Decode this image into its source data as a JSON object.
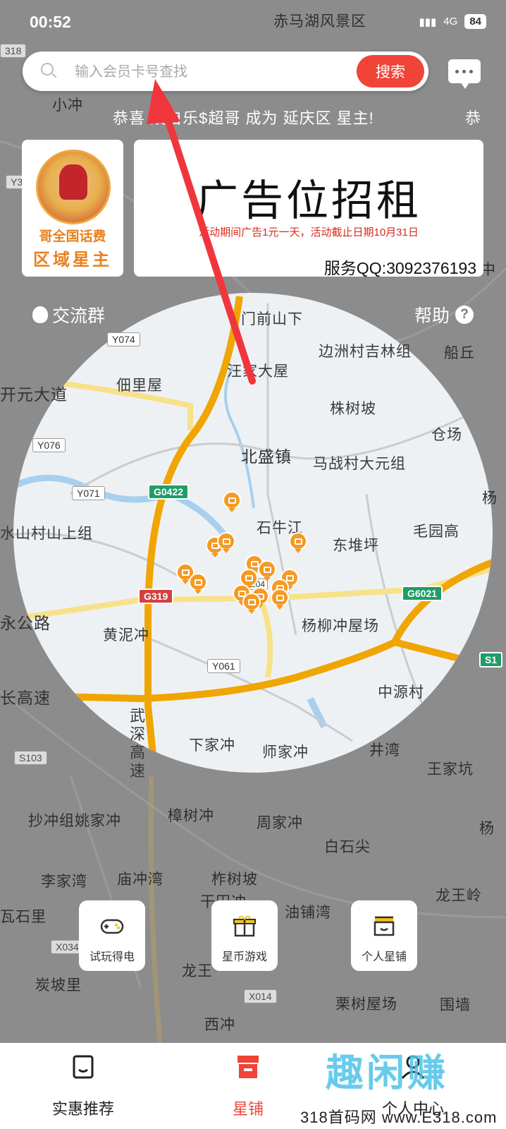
{
  "status_bar": {
    "time": "00:52",
    "network": "4G",
    "battery": "84"
  },
  "search": {
    "placeholder": "输入会员卡号查找",
    "button_label": "搜索"
  },
  "marquee": {
    "text": "恭喜 娱自乐$超哥 成为 延庆区 星主!",
    "next": "恭"
  },
  "banners": {
    "logo_line1": "哥全国话费",
    "logo_line2": "区域星主",
    "ad_title": "广告位招租",
    "ad_subtitle": "活动期间广告1元一天，活动截止日期10月31日",
    "ad_contact": "服务QQ:3092376193"
  },
  "links": {
    "group": "交流群",
    "help": "帮助"
  },
  "map": {
    "places": [
      {
        "name": "赤马湖风景区"
      },
      {
        "name": "小冲"
      },
      {
        "name": "门前山下"
      },
      {
        "name": "边洲村吉林组"
      },
      {
        "name": "船丘"
      },
      {
        "name": "汪家大屋"
      },
      {
        "name": "佃里屋"
      },
      {
        "name": "开元大道"
      },
      {
        "name": "株树坡"
      },
      {
        "name": "仓场"
      },
      {
        "name": "北盛镇"
      },
      {
        "name": "马战村大元组"
      },
      {
        "name": "石牛江"
      },
      {
        "name": "东堆坪"
      },
      {
        "name": "毛园高"
      },
      {
        "name": "水山村山上组"
      },
      {
        "name": "永公路"
      },
      {
        "name": "黄泥冲"
      },
      {
        "name": "杨柳冲屋场"
      },
      {
        "name": "中源村"
      },
      {
        "name": "长高速"
      },
      {
        "name": "武深高速"
      },
      {
        "name": "下家冲"
      },
      {
        "name": "师家冲"
      },
      {
        "name": "井湾"
      },
      {
        "name": "王家坑"
      },
      {
        "name": "抄冲组姚家冲"
      },
      {
        "name": "樟树冲"
      },
      {
        "name": "周家冲"
      },
      {
        "name": "白石尖"
      },
      {
        "name": "李家湾"
      },
      {
        "name": "庙冲湾"
      },
      {
        "name": "柞树坡"
      },
      {
        "name": "龙王岭"
      },
      {
        "name": "瓦石里"
      },
      {
        "name": "油铺湾"
      },
      {
        "name": "炭坡里"
      },
      {
        "name": "栗树屋场"
      },
      {
        "name": "围墙"
      },
      {
        "name": "西冲"
      },
      {
        "name": "龙王"
      },
      {
        "name": "干田冲"
      },
      {
        "name": "中"
      },
      {
        "name": "杨"
      },
      {
        "name": "杨"
      }
    ],
    "road_badges": [
      "Y074",
      "Y076",
      "Y071",
      "G0422",
      "G319",
      "G6021",
      "Y061",
      "S103",
      "X034",
      "X014",
      "318",
      "Y3",
      "204",
      "S1"
    ]
  },
  "actions": [
    {
      "label": "试玩得电",
      "icon": "gamepad-icon"
    },
    {
      "label": "星币游戏",
      "icon": "gift-icon"
    },
    {
      "label": "个人星铺",
      "icon": "shop-icon"
    }
  ],
  "tabs": [
    {
      "label": "实惠推荐",
      "icon": "bag-icon"
    },
    {
      "label": "星铺",
      "icon": "store-icon"
    },
    {
      "label": "个人中心",
      "icon": "user-icon"
    }
  ],
  "watermark": {
    "brand": "趣闲赚",
    "site": "318首码网 www.E318.com"
  },
  "colors": {
    "accent": "#f04438",
    "pin": "#f59a23",
    "highway": "#f0a500",
    "link": "#4ec3e8"
  }
}
